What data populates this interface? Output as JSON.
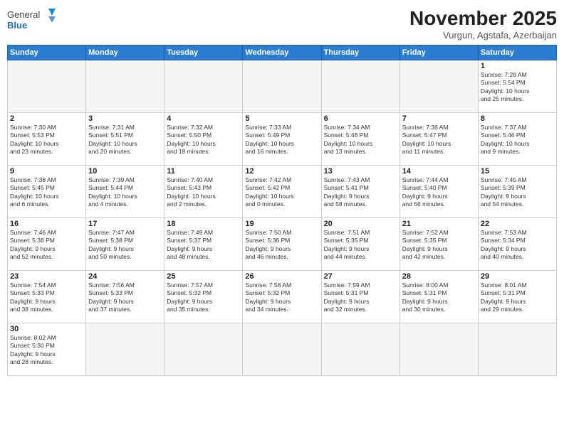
{
  "logo": {
    "text_general": "General",
    "text_blue": "Blue"
  },
  "header": {
    "month_year": "November 2025",
    "location": "Vurgun, Agstafa, Azerbaijan"
  },
  "weekdays": [
    "Sunday",
    "Monday",
    "Tuesday",
    "Wednesday",
    "Thursday",
    "Friday",
    "Saturday"
  ],
  "weeks": [
    [
      {
        "day": "",
        "info": ""
      },
      {
        "day": "",
        "info": ""
      },
      {
        "day": "",
        "info": ""
      },
      {
        "day": "",
        "info": ""
      },
      {
        "day": "",
        "info": ""
      },
      {
        "day": "",
        "info": ""
      },
      {
        "day": "1",
        "info": "Sunrise: 7:28 AM\nSunset: 5:54 PM\nDaylight: 10 hours\nand 25 minutes."
      }
    ],
    [
      {
        "day": "2",
        "info": "Sunrise: 7:30 AM\nSunset: 5:53 PM\nDaylight: 10 hours\nand 23 minutes."
      },
      {
        "day": "3",
        "info": "Sunrise: 7:31 AM\nSunset: 5:51 PM\nDaylight: 10 hours\nand 20 minutes."
      },
      {
        "day": "4",
        "info": "Sunrise: 7:32 AM\nSunset: 5:50 PM\nDaylight: 10 hours\nand 18 minutes."
      },
      {
        "day": "5",
        "info": "Sunrise: 7:33 AM\nSunset: 5:49 PM\nDaylight: 10 hours\nand 16 minutes."
      },
      {
        "day": "6",
        "info": "Sunrise: 7:34 AM\nSunset: 5:48 PM\nDaylight: 10 hours\nand 13 minutes."
      },
      {
        "day": "7",
        "info": "Sunrise: 7:36 AM\nSunset: 5:47 PM\nDaylight: 10 hours\nand 11 minutes."
      },
      {
        "day": "8",
        "info": "Sunrise: 7:37 AM\nSunset: 5:46 PM\nDaylight: 10 hours\nand 9 minutes."
      }
    ],
    [
      {
        "day": "9",
        "info": "Sunrise: 7:38 AM\nSunset: 5:45 PM\nDaylight: 10 hours\nand 6 minutes."
      },
      {
        "day": "10",
        "info": "Sunrise: 7:39 AM\nSunset: 5:44 PM\nDaylight: 10 hours\nand 4 minutes."
      },
      {
        "day": "11",
        "info": "Sunrise: 7:40 AM\nSunset: 5:43 PM\nDaylight: 10 hours\nand 2 minutes."
      },
      {
        "day": "12",
        "info": "Sunrise: 7:42 AM\nSunset: 5:42 PM\nDaylight: 10 hours\nand 0 minutes."
      },
      {
        "day": "13",
        "info": "Sunrise: 7:43 AM\nSunset: 5:41 PM\nDaylight: 9 hours\nand 58 minutes."
      },
      {
        "day": "14",
        "info": "Sunrise: 7:44 AM\nSunset: 5:40 PM\nDaylight: 9 hours\nand 56 minutes."
      },
      {
        "day": "15",
        "info": "Sunrise: 7:45 AM\nSunset: 5:39 PM\nDaylight: 9 hours\nand 54 minutes."
      }
    ],
    [
      {
        "day": "16",
        "info": "Sunrise: 7:46 AM\nSunset: 5:38 PM\nDaylight: 9 hours\nand 52 minutes."
      },
      {
        "day": "17",
        "info": "Sunrise: 7:47 AM\nSunset: 5:38 PM\nDaylight: 9 hours\nand 50 minutes."
      },
      {
        "day": "18",
        "info": "Sunrise: 7:49 AM\nSunset: 5:37 PM\nDaylight: 9 hours\nand 48 minutes."
      },
      {
        "day": "19",
        "info": "Sunrise: 7:50 AM\nSunset: 5:36 PM\nDaylight: 9 hours\nand 46 minutes."
      },
      {
        "day": "20",
        "info": "Sunrise: 7:51 AM\nSunset: 5:35 PM\nDaylight: 9 hours\nand 44 minutes."
      },
      {
        "day": "21",
        "info": "Sunrise: 7:52 AM\nSunset: 5:35 PM\nDaylight: 9 hours\nand 42 minutes."
      },
      {
        "day": "22",
        "info": "Sunrise: 7:53 AM\nSunset: 5:34 PM\nDaylight: 9 hours\nand 40 minutes."
      }
    ],
    [
      {
        "day": "23",
        "info": "Sunrise: 7:54 AM\nSunset: 5:33 PM\nDaylight: 9 hours\nand 38 minutes."
      },
      {
        "day": "24",
        "info": "Sunrise: 7:56 AM\nSunset: 5:33 PM\nDaylight: 9 hours\nand 37 minutes."
      },
      {
        "day": "25",
        "info": "Sunrise: 7:57 AM\nSunset: 5:32 PM\nDaylight: 9 hours\nand 35 minutes."
      },
      {
        "day": "26",
        "info": "Sunrise: 7:58 AM\nSunset: 5:32 PM\nDaylight: 9 hours\nand 34 minutes."
      },
      {
        "day": "27",
        "info": "Sunrise: 7:59 AM\nSunset: 5:31 PM\nDaylight: 9 hours\nand 32 minutes."
      },
      {
        "day": "28",
        "info": "Sunrise: 8:00 AM\nSunset: 5:31 PM\nDaylight: 9 hours\nand 30 minutes."
      },
      {
        "day": "29",
        "info": "Sunrise: 8:01 AM\nSunset: 5:31 PM\nDaylight: 9 hours\nand 29 minutes."
      }
    ],
    [
      {
        "day": "30",
        "info": "Sunrise: 8:02 AM\nSunset: 5:30 PM\nDaylight: 9 hours\nand 28 minutes."
      },
      {
        "day": "",
        "info": ""
      },
      {
        "day": "",
        "info": ""
      },
      {
        "day": "",
        "info": ""
      },
      {
        "day": "",
        "info": ""
      },
      {
        "day": "",
        "info": ""
      },
      {
        "day": "",
        "info": ""
      }
    ]
  ]
}
